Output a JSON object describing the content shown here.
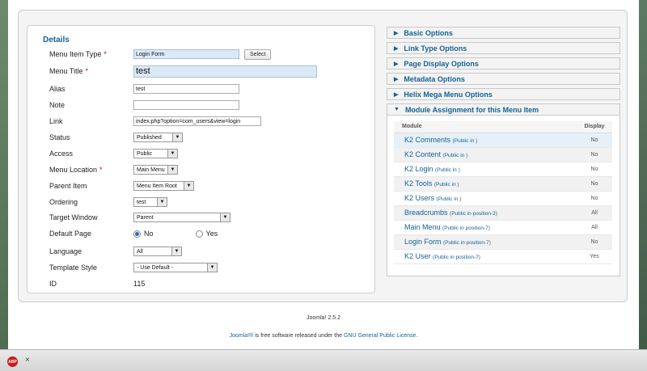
{
  "details": {
    "legend": "Details",
    "menu_item_type": {
      "label": "Menu Item Type",
      "value": "Login Form",
      "button": "Select"
    },
    "menu_title": {
      "label": "Menu Title",
      "value": "test"
    },
    "alias": {
      "label": "Alias",
      "value": "test"
    },
    "note": {
      "label": "Note",
      "value": ""
    },
    "link": {
      "label": "Link",
      "value": "index.php?option=com_users&view=login"
    },
    "status": {
      "label": "Status",
      "value": "Published"
    },
    "access": {
      "label": "Access",
      "value": "Public"
    },
    "menu_location": {
      "label": "Menu Location",
      "value": "Main Menu"
    },
    "parent_item": {
      "label": "Parent Item",
      "value": "Menu Item Root"
    },
    "ordering": {
      "label": "Ordering",
      "value": "test"
    },
    "target_window": {
      "label": "Target Window",
      "value": "Parent"
    },
    "default_page": {
      "label": "Default Page",
      "no": "No",
      "yes": "Yes",
      "selected": "No"
    },
    "language": {
      "label": "Language",
      "value": "All"
    },
    "template_style": {
      "label": "Template Style",
      "value": "- Use Default -"
    },
    "id": {
      "label": "ID",
      "value": "115"
    },
    "required_mark": "*"
  },
  "sidebar": {
    "panels": [
      {
        "label": "Basic Options"
      },
      {
        "label": "Link Type Options"
      },
      {
        "label": "Page Display Options"
      },
      {
        "label": "Metadata Options"
      },
      {
        "label": "Helix Mega Menu Options"
      },
      {
        "label": "Module Assignment for this Menu Item"
      }
    ],
    "module_table": {
      "headers": {
        "module": "Module",
        "display": "Display"
      },
      "rows": [
        {
          "name": "K2 Comments",
          "note": "(Public in )",
          "display": "No"
        },
        {
          "name": "K2 Content",
          "note": "(Public in )",
          "display": "No"
        },
        {
          "name": "K2 Login",
          "note": "(Public in )",
          "display": "No"
        },
        {
          "name": "K2 Tools",
          "note": "(Public in )",
          "display": "No"
        },
        {
          "name": "K2 Users",
          "note": "(Public in )",
          "display": "No"
        },
        {
          "name": "Breadcrumbs",
          "note": "(Public in position-2)",
          "display": "All"
        },
        {
          "name": "Main Menu",
          "note": "(Public in position-7)",
          "display": "All"
        },
        {
          "name": "Login Form",
          "note": "(Public in position-7)",
          "display": "No"
        },
        {
          "name": "K2 User",
          "note": "(Public in position-7)",
          "display": "Yes"
        }
      ]
    }
  },
  "footer": {
    "version": "Joomla! 2.5.2",
    "license_link1": "Joomla!®",
    "license_text": " is free software released under the ",
    "license_link2": "GNU General Public License",
    "license_end": "."
  },
  "statusbar": {
    "abp_label": "ABP",
    "close": "×"
  }
}
